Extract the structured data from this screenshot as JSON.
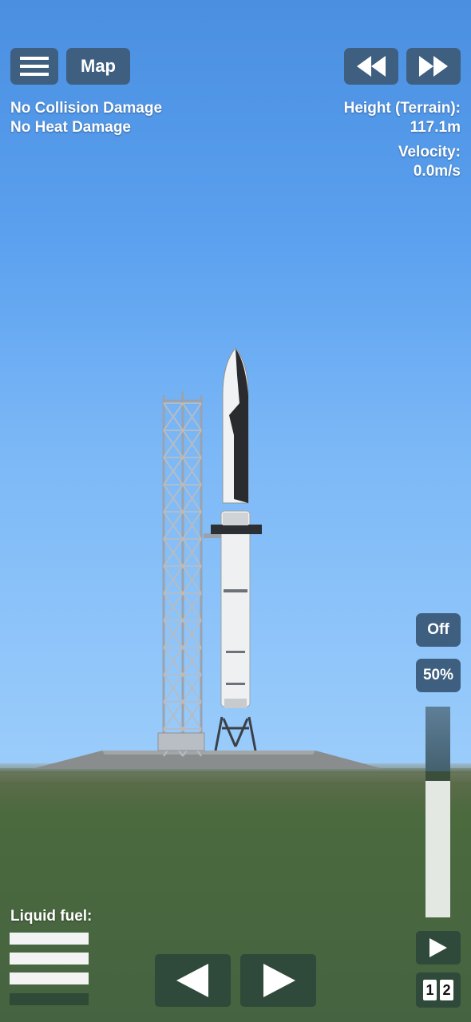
{
  "top_bar": {
    "menu_icon": "hamburger-menu-icon",
    "map_label": "Map",
    "rewind_icon": "rewind-icon",
    "fast_forward_icon": "fast-forward-icon"
  },
  "status": {
    "line1": "No Collision Damage",
    "line2": "No Heat Damage"
  },
  "telemetry": {
    "height_label": "Height (Terrain):",
    "height_value": "117.1m",
    "velocity_label": "Velocity:",
    "velocity_value": "0.0m/s"
  },
  "controls": {
    "sas_label": "Off",
    "throttle_label": "50%",
    "throttle_level": 0.35,
    "stage_icon": "play-icon",
    "stage_digits": [
      "1",
      "2"
    ]
  },
  "fuel": {
    "label": "Liquid fuel:",
    "bars_full": 3,
    "bars_total": 4
  },
  "navigation": {
    "left_icon": "left-arrow-icon",
    "right_icon": "right-arrow-icon"
  },
  "colors": {
    "button": "#3f5f80",
    "dark_button": "#2f4a3a",
    "ground": "#456340",
    "sky_top": "#4a8fe0"
  }
}
